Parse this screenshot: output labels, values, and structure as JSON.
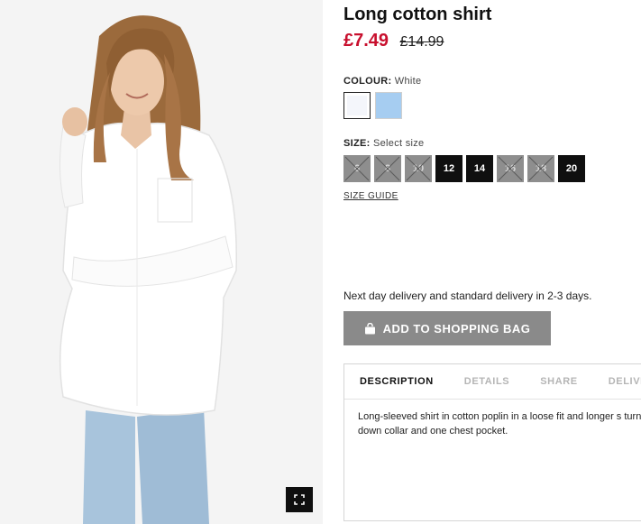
{
  "product": {
    "title": "Long cotton shirt",
    "price_sale": "£7.49",
    "price_original": "£14.99"
  },
  "colour": {
    "label": "COLOUR:",
    "selected": "White",
    "swatches": [
      {
        "name": "White",
        "hex": "#f4f6fb",
        "selected": true
      },
      {
        "name": "Light blue",
        "hex": "#a6cdf1",
        "selected": false
      }
    ]
  },
  "size": {
    "label": "SIZE:",
    "prompt": "Select size",
    "options": [
      {
        "label": "6",
        "available": false
      },
      {
        "label": "8",
        "available": false
      },
      {
        "label": "10",
        "available": false
      },
      {
        "label": "12",
        "available": true
      },
      {
        "label": "14",
        "available": true
      },
      {
        "label": "16",
        "available": false
      },
      {
        "label": "18",
        "available": false
      },
      {
        "label": "20",
        "available": true
      }
    ],
    "guide_label": "SIZE GUIDE"
  },
  "delivery_text": "Next day delivery and standard delivery in 2-3 days.",
  "add_to_bag_label": "ADD TO SHOPPING BAG",
  "tabs": [
    {
      "label": "DESCRIPTION",
      "active": true
    },
    {
      "label": "DETAILS",
      "active": false
    },
    {
      "label": "SHARE",
      "active": false
    },
    {
      "label": "DELIVI",
      "active": false
    }
  ],
  "description": "Long-sleeved shirt in cotton poplin in a loose fit and longer s turn-down collar and one chest pocket.",
  "colors": {
    "sale_red": "#c8102e",
    "button_grey": "#8a8a8a",
    "size_available": "#0f0f0f",
    "size_unavailable": "#8e8e8e"
  },
  "icons": [
    "fullscreen-icon",
    "shopping-bag-icon",
    "cross-out-icon"
  ]
}
